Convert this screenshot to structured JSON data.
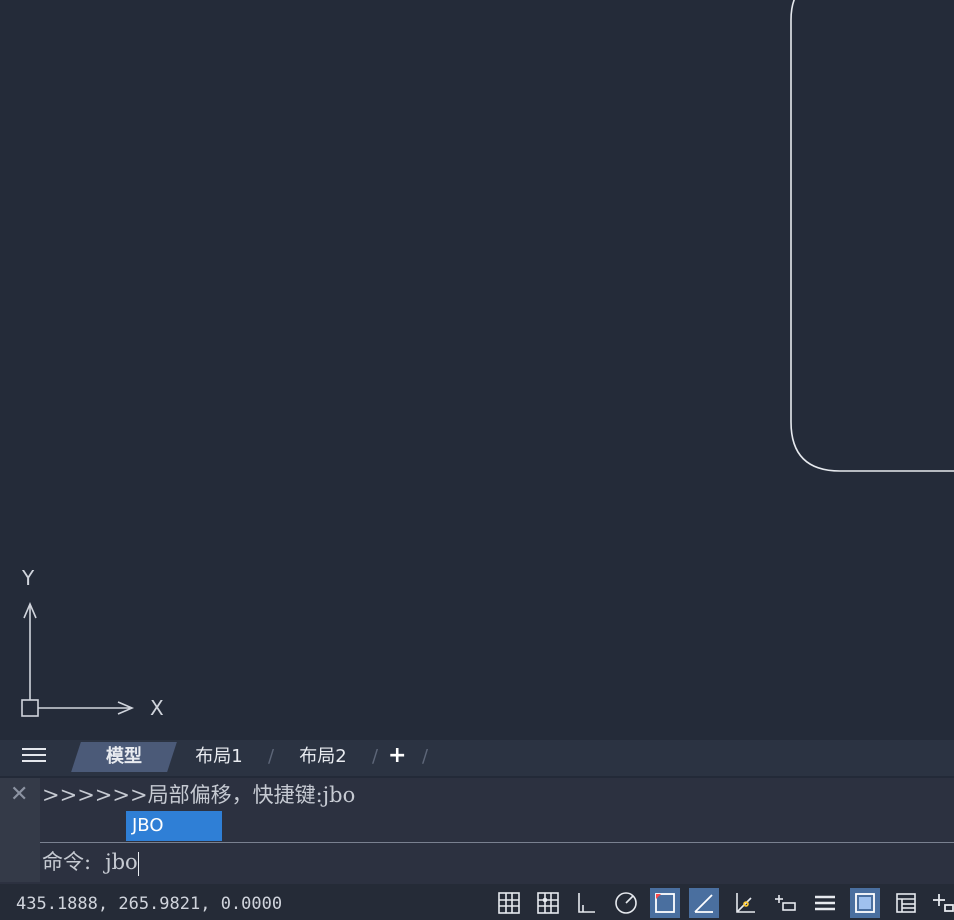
{
  "canvas": {
    "ucs_x_label": "X",
    "ucs_y_label": "Y",
    "background_color": "#242b39"
  },
  "tabs": {
    "menu_icon": "hamburger-icon",
    "items": [
      {
        "label": "模型",
        "active": true
      },
      {
        "label": "布局1",
        "active": false
      },
      {
        "label": "布局2",
        "active": false
      }
    ],
    "add_label": "+"
  },
  "command": {
    "history": ">>>>>>局部偏移，快捷键:jbo",
    "suggestion": "JBO",
    "prompt": "命令:",
    "input_value": "jbo",
    "accent_color": "#2f7fd6"
  },
  "status_bar": {
    "coordinates": "435.1888,  265.9821,  0.0000",
    "toggles": [
      {
        "icon": "grid-display-icon",
        "on": false
      },
      {
        "icon": "snap-grid-icon",
        "on": false
      },
      {
        "icon": "ortho-icon",
        "on": false
      },
      {
        "icon": "polar-tracking-icon",
        "on": false
      },
      {
        "icon": "object-snap-icon",
        "on": true
      },
      {
        "icon": "object-snap-tracking-icon",
        "on": true
      },
      {
        "icon": "dynamic-ucs-icon",
        "on": false
      },
      {
        "icon": "dynamic-input-icon",
        "on": false
      },
      {
        "icon": "lineweight-icon",
        "on": false
      },
      {
        "icon": "transparency-icon",
        "on": true
      },
      {
        "icon": "properties-icon",
        "on": false
      },
      {
        "icon": "add-tool-icon",
        "on": false
      }
    ]
  }
}
